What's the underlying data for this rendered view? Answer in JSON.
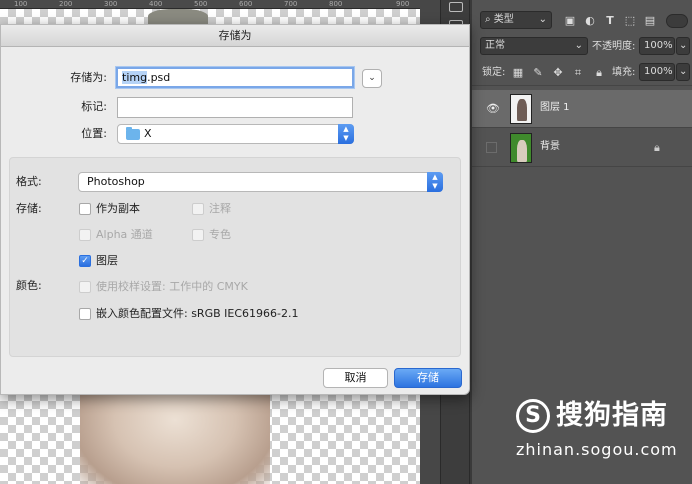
{
  "ruler": {
    "ticks": [
      "100",
      "200",
      "300",
      "400",
      "500",
      "600",
      "700",
      "800",
      "900"
    ]
  },
  "layers_panel": {
    "filter_kind": "类型",
    "blend_mode": "正常",
    "opacity_label": "不透明度:",
    "opacity_value": "100%",
    "lock_label": "锁定:",
    "fill_label": "填充:",
    "fill_value": "100%",
    "layers": [
      {
        "name": "图层 1",
        "visible": true,
        "selected": true,
        "locked": false
      },
      {
        "name": "背景",
        "visible": false,
        "selected": false,
        "locked": true
      }
    ]
  },
  "dialog": {
    "title": "存储为",
    "save_as_label": "存储为:",
    "filename_selected": "timg",
    "filename_rest": ".psd",
    "tags_label": "标记:",
    "tags_value": "",
    "location_label": "位置:",
    "location_value": "X",
    "format_label": "格式:",
    "format_value": "Photoshop",
    "save_options_label": "存储:",
    "options": {
      "as_copy": {
        "label": "作为副本",
        "checked": false,
        "enabled": true
      },
      "notes": {
        "label": "注释",
        "checked": false,
        "enabled": false
      },
      "alpha": {
        "label": "Alpha 通道",
        "checked": false,
        "enabled": false
      },
      "spot": {
        "label": "专色",
        "checked": false,
        "enabled": false
      },
      "layers": {
        "label": "图层",
        "checked": true,
        "enabled": true
      }
    },
    "color_label": "颜色:",
    "color_options": {
      "proof": {
        "label": "使用校样设置: 工作中的 CMYK",
        "checked": false,
        "enabled": false
      },
      "embed_profile": {
        "label": "嵌入颜色配置文件: sRGB IEC61966-2.1",
        "checked": false,
        "enabled": true
      }
    },
    "cancel_label": "取消",
    "save_label": "存储"
  },
  "watermark": {
    "logo_letter": "S",
    "title": "搜狗指南",
    "url": "zhinan.sogou.com"
  },
  "colors": {
    "accent": "#2d73e0",
    "panel_bg": "#535353",
    "dialog_bg": "#ececec"
  }
}
